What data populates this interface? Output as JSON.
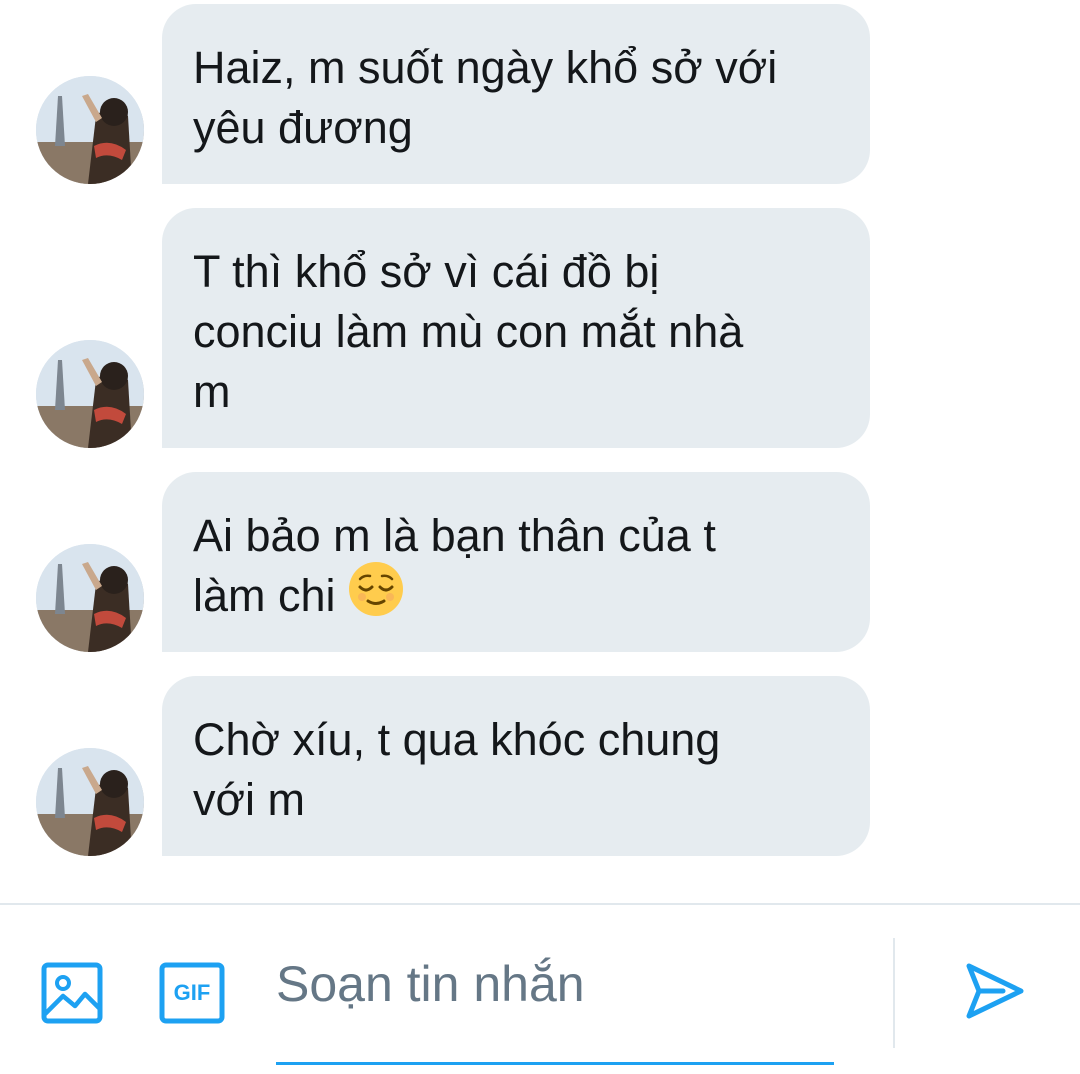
{
  "messages": [
    {
      "avatar_icon": "user-avatar-photo",
      "lines": [
        "Haiz, m suốt ngày khổ sở với",
        "yêu đương"
      ]
    },
    {
      "avatar_icon": "user-avatar-photo",
      "lines": [
        "T thì khổ sở vì cái đồ bị",
        "conciu làm mù con mắt nhà",
        "m"
      ]
    },
    {
      "avatar_icon": "user-avatar-photo",
      "lines": [
        "Ai bảo m là bạn thân của t",
        "làm chi"
      ],
      "emoji": "relieved-face-emoji"
    },
    {
      "avatar_icon": "user-avatar-photo",
      "lines": [
        "Chờ xíu, t qua khóc chung",
        "với m"
      ]
    }
  ],
  "composer": {
    "placeholder": "Soạn tin nhắn",
    "gif_label": "GIF",
    "image_icon": "image-icon",
    "gif_icon": "gif-icon",
    "send_icon": "send-icon"
  },
  "colors": {
    "accent": "#1da1f2",
    "bubble_bg": "#e6ecf0",
    "text": "#14171a",
    "placeholder": "#657786"
  }
}
